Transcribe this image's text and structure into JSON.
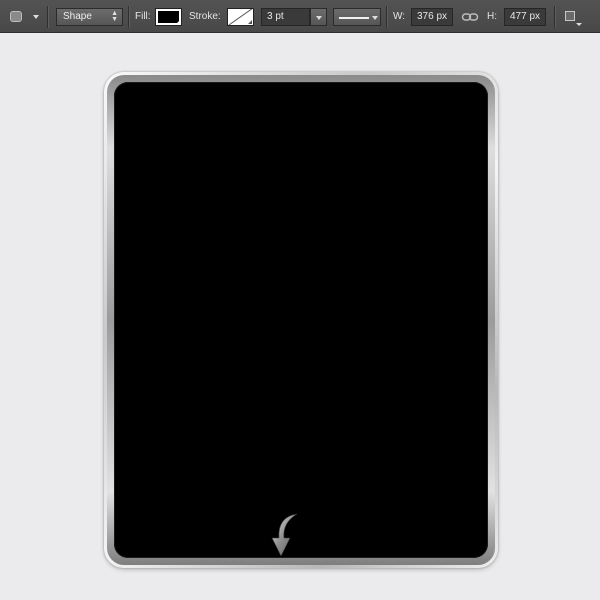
{
  "toolbar": {
    "tool_icon": "rounded-rectangle-tool-icon",
    "mode_value": "Shape",
    "fill_label": "Fill:",
    "fill_color": "#000000",
    "stroke_label": "Stroke:",
    "stroke_swatch": "no-stroke-slash",
    "stroke_width_value": "3 pt",
    "stroke_style_icon": "line-style-icon",
    "width_label": "W:",
    "width_value": "376 px",
    "link_icon": "link-icon",
    "height_label": "H:",
    "height_value": "477 px",
    "path_ops_icon": "path-operations-icon"
  },
  "canvas": {
    "background": "#ebeaec",
    "shape": {
      "type": "rounded-rectangle",
      "fill": "#000000",
      "bezel": "silver-metallic"
    },
    "annotation_icon": "curved-down-arrow-icon"
  }
}
